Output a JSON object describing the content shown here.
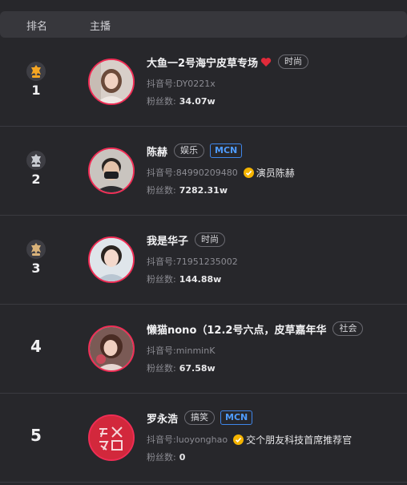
{
  "header": {
    "rank_label": "排名",
    "host_label": "主播"
  },
  "fans_label": "粉丝数:",
  "rows": [
    {
      "rank": "1",
      "medal": "gold",
      "name": "大鱼一2号海宁皮草专场",
      "tag": "时尚",
      "mcn": "",
      "douyin": "抖音号:DY0221x",
      "verify_text": "",
      "fans": "34.07w"
    },
    {
      "rank": "2",
      "medal": "silver",
      "name": "陈赫",
      "tag": "娱乐",
      "mcn": "MCN",
      "douyin": "抖音号:84990209480",
      "verify_text": "演员陈赫",
      "fans": "7282.31w"
    },
    {
      "rank": "3",
      "medal": "bronze",
      "name": "我是华子",
      "tag": "时尚",
      "mcn": "",
      "douyin": "抖音号:71951235002",
      "verify_text": "",
      "fans": "144.88w"
    },
    {
      "rank": "4",
      "medal": "",
      "name": "懒猫nono（12.2号六点，皮草嘉年华",
      "tag": "社会",
      "mcn": "",
      "douyin": "抖音号:minminK",
      "verify_text": "",
      "fans": "67.58w"
    },
    {
      "rank": "5",
      "medal": "",
      "name": "罗永浩",
      "tag": "搞笑",
      "mcn": "MCN",
      "douyin": "抖音号:luoyonghao",
      "verify_text": "交个朋友科技首席推荐官",
      "fans": "0"
    }
  ],
  "colors": {
    "gold": "#f5a623",
    "silver": "#c9ccd2",
    "bronze": "#d9b27a",
    "accent_red": "#ef2d55",
    "mcn_blue": "#3f86ea",
    "verify_yellow": "#f5b400"
  }
}
